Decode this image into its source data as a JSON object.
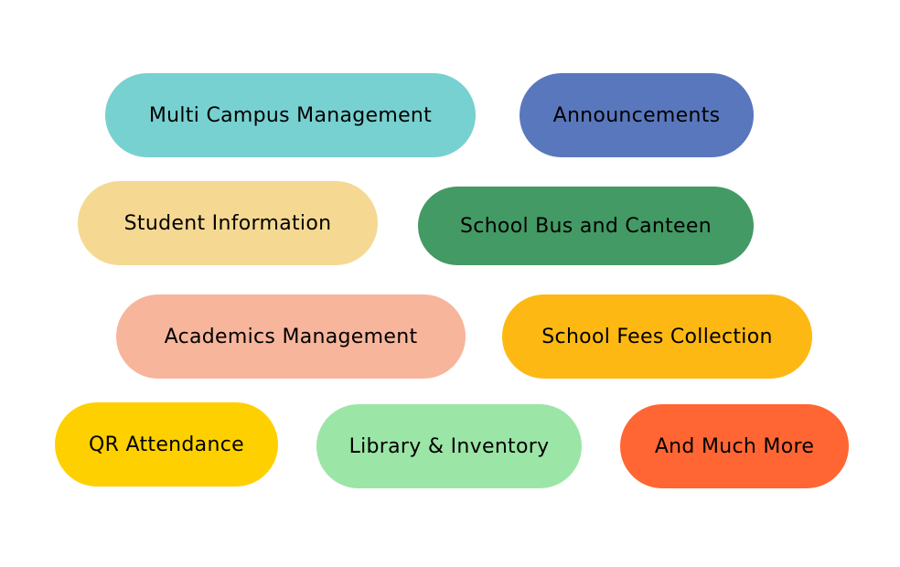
{
  "features": [
    {
      "label": "Multi Campus Management",
      "color": "#77d1d0"
    },
    {
      "label": "Announcements",
      "color": "#5977bc"
    },
    {
      "label": "Student Information",
      "color": "#f5d993"
    },
    {
      "label": "School Bus and Canteen",
      "color": "#439a64"
    },
    {
      "label": "Academics Management",
      "color": "#f7b59c"
    },
    {
      "label": "School Fees Collection",
      "color": "#fdb813"
    },
    {
      "label": "QR Attendance",
      "color": "#ffd000"
    },
    {
      "label": "Library & Inventory",
      "color": "#9be5a6"
    },
    {
      "label": "And Much More",
      "color": "#ff6633"
    }
  ]
}
